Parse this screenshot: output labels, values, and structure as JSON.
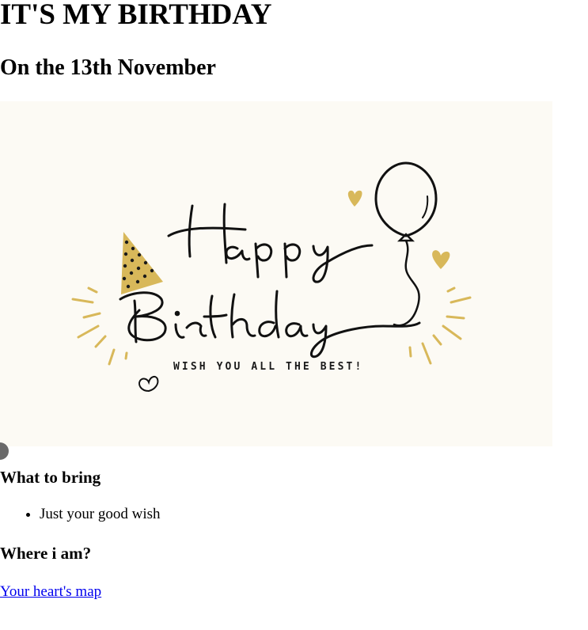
{
  "header": {
    "title": "IT'S MY BIRTHDAY",
    "subtitle": "On the 13th November"
  },
  "card": {
    "script_line1": "Happy",
    "script_line2": "Birthday",
    "wish_text": "WISH YOU ALL THE BEST!",
    "background_color": "#fcfaf4",
    "accent_color": "#d8b85a",
    "ink_color": "#111111",
    "icons": [
      "party-hat-icon",
      "balloon-icon",
      "heart-icon"
    ]
  },
  "bring": {
    "heading": "What to bring",
    "items": [
      "Just your good wish"
    ]
  },
  "location": {
    "heading": "Where i am?",
    "link_text": "Your heart's map"
  },
  "colors": {
    "link": "#0000ee"
  }
}
